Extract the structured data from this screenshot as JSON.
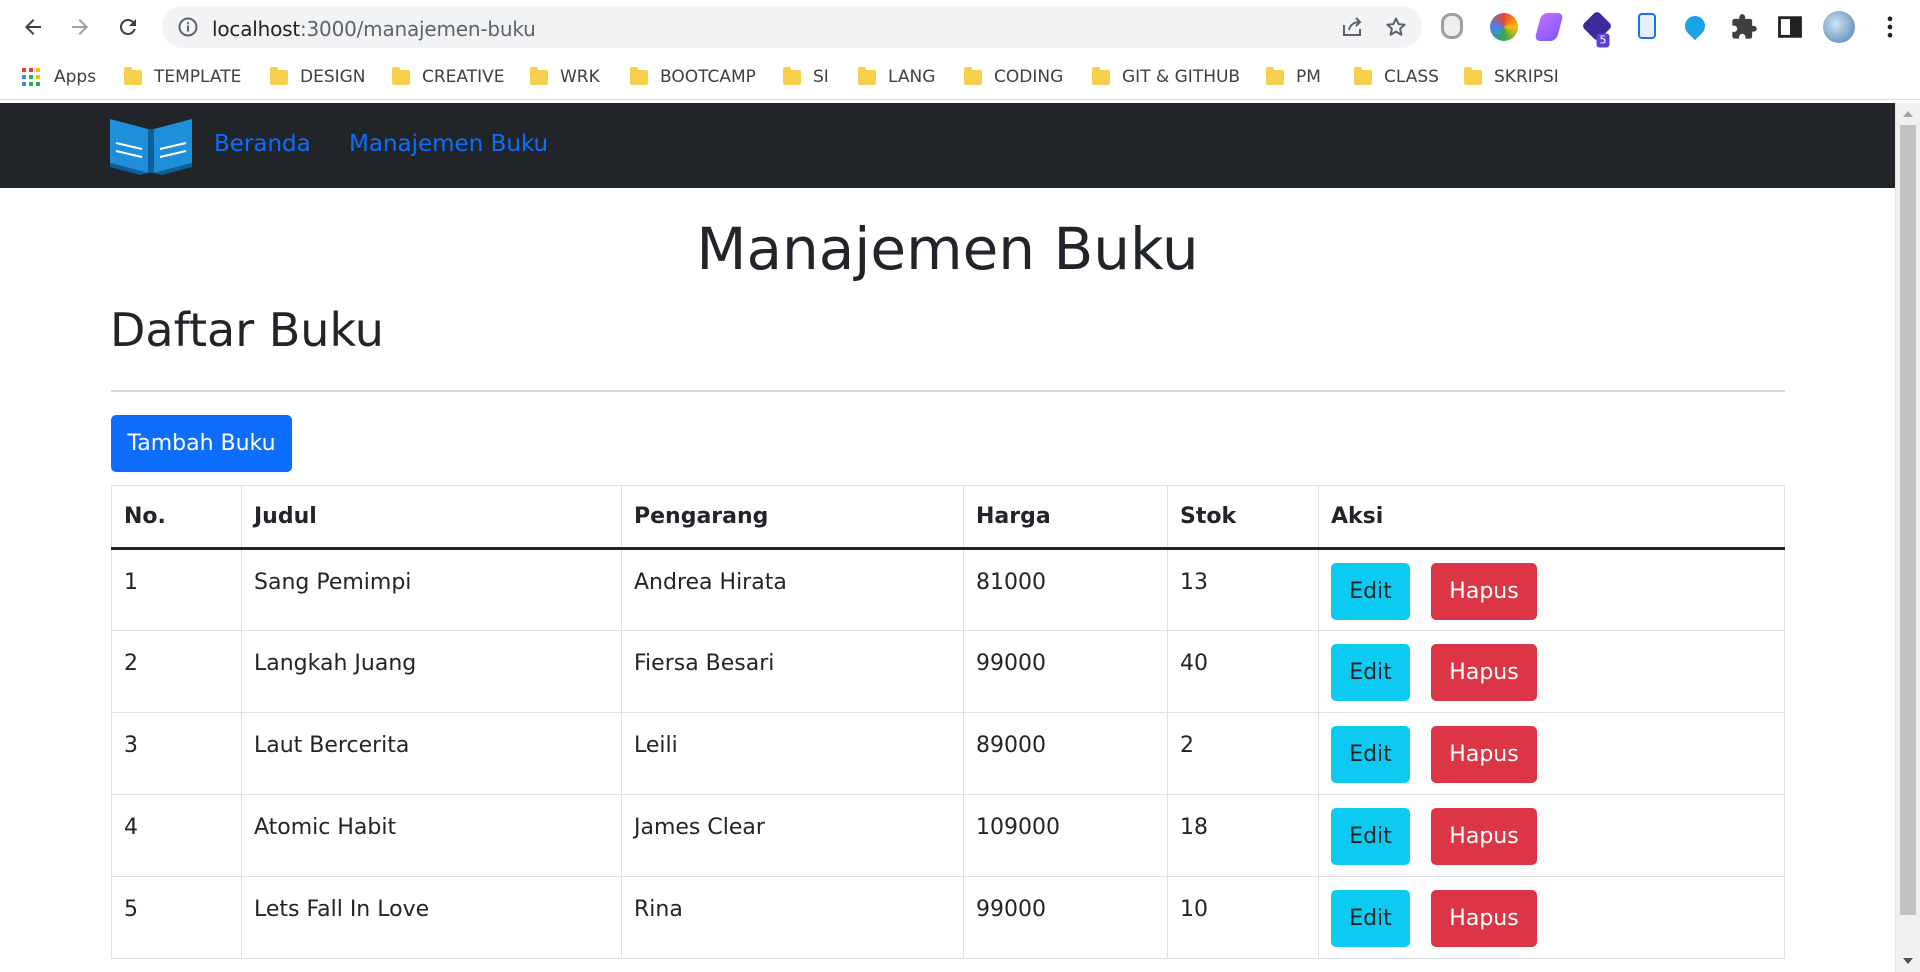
{
  "browser": {
    "url_host": "localhost",
    "url_path": ":3000/manajemen-buku",
    "extension_badge": "5",
    "bookmarks": {
      "apps_label": "Apps",
      "folders": [
        "TEMPLATE",
        "DESIGN",
        "CREATIVE",
        "WRK",
        "BOOTCAMP",
        "SI",
        "LANG",
        "CODING",
        "GIT & GITHUB",
        "PM",
        "CLASS",
        "SKRIPSI"
      ]
    }
  },
  "navbar": {
    "links": [
      "Beranda",
      "Manajemen Buku"
    ]
  },
  "main": {
    "page_title": "Manajemen Buku",
    "section_title": "Daftar Buku",
    "add_button": "Tambah Buku",
    "table": {
      "headers": [
        "No.",
        "Judul",
        "Pengarang",
        "Harga",
        "Stok",
        "Aksi"
      ],
      "rows": [
        {
          "no": "1",
          "judul": "Sang Pemimpi",
          "pengarang": "Andrea Hirata",
          "harga": "81000",
          "stok": "13"
        },
        {
          "no": "2",
          "judul": "Langkah Juang",
          "pengarang": "Fiersa Besari",
          "harga": "99000",
          "stok": "40"
        },
        {
          "no": "3",
          "judul": "Laut Bercerita",
          "pengarang": "Leili",
          "harga": "89000",
          "stok": "2"
        },
        {
          "no": "4",
          "judul": "Atomic Habit",
          "pengarang": "James Clear",
          "harga": "109000",
          "stok": "18"
        },
        {
          "no": "5",
          "judul": "Lets Fall In Love",
          "pengarang": "Rina",
          "harga": "99000",
          "stok": "10"
        }
      ],
      "edit_label": "Edit",
      "delete_label": "Hapus"
    }
  },
  "colors": {
    "navbar_bg": "#212529",
    "primary": "#0d6efd",
    "info": "#0dcaf0",
    "danger": "#dc3545"
  }
}
